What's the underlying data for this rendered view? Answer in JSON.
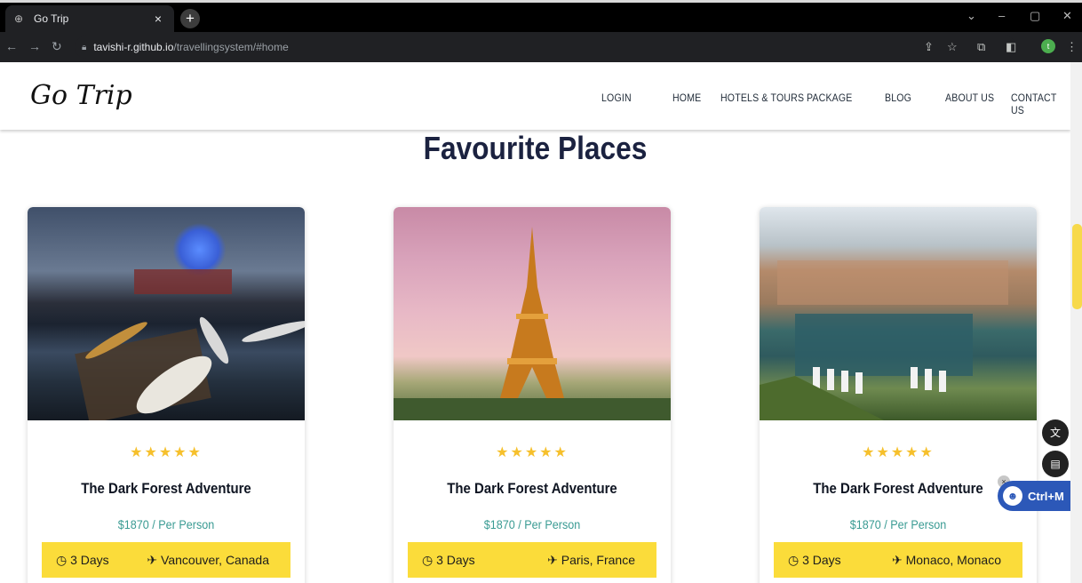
{
  "browser": {
    "tab_title": "Go Trip",
    "url_host": "tavishi-r.github.io",
    "url_path": "/travellingsystem/#home",
    "profile_initial": "t"
  },
  "site": {
    "logo": "Go Trip",
    "nav": [
      {
        "label": "LOGIN"
      },
      {
        "label": "HOME"
      },
      {
        "label": "HOTELS & TOURS"
      },
      {
        "label": "PACKAGE"
      },
      {
        "label": "BLOG"
      },
      {
        "label": "ABOUT US"
      },
      {
        "label": "CONTACT US"
      }
    ]
  },
  "section": {
    "title": "Favourite Places"
  },
  "cards": [
    {
      "stars": "★★★★★",
      "title": "The Dark Forest Adventure",
      "price": "$1870 / Per Person",
      "days": "3 Days",
      "location": "Vancouver, Canada"
    },
    {
      "stars": "★★★★★",
      "title": "The Dark Forest Adventure",
      "price": "$1870 / Per Person",
      "days": "3 Days",
      "location": "Paris, France"
    },
    {
      "stars": "★★★★★",
      "title": "The Dark Forest Adventure",
      "price": "$1870 / Per Person",
      "days": "3 Days",
      "location": "Monaco, Monaco"
    }
  ],
  "extension": {
    "label": "Ctrl+M"
  },
  "icons": {
    "clock": "clock-icon",
    "plane": "airplane-icon",
    "translate": "translate-icon",
    "reader": "reader-icon"
  },
  "colors": {
    "accent_yellow": "#fbdc3a",
    "star": "#f6c02c",
    "price_teal": "#3a9b93",
    "heading_navy": "#1b2240"
  }
}
